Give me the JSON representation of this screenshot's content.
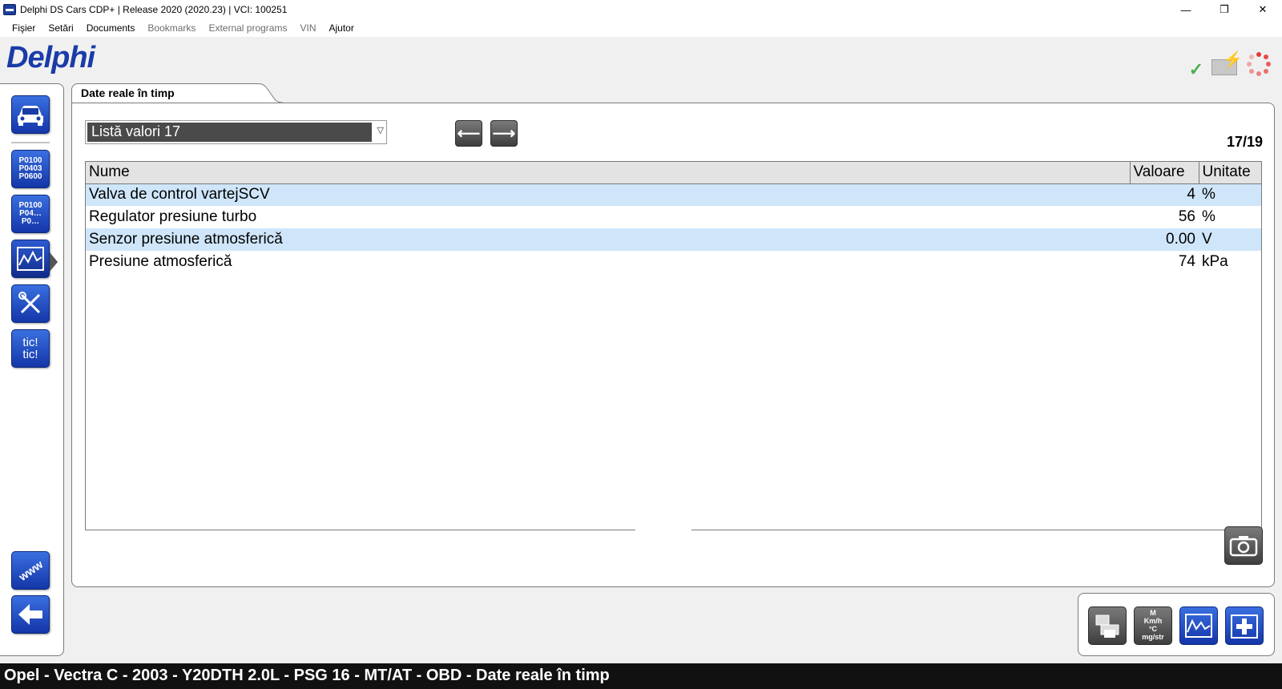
{
  "window": {
    "title": "Delphi DS Cars CDP+ | Release 2020 (2020.23)  |  VCI: 100251",
    "minimize": "—",
    "restore": "❐",
    "close": "✕"
  },
  "menu": {
    "items": [
      {
        "label": "Fişier",
        "enabled": true
      },
      {
        "label": "Setări",
        "enabled": true
      },
      {
        "label": "Documents",
        "enabled": true
      },
      {
        "label": "Bookmarks",
        "enabled": false
      },
      {
        "label": "External programs",
        "enabled": false
      },
      {
        "label": "VIN",
        "enabled": false
      },
      {
        "label": "Ajutor",
        "enabled": true
      }
    ]
  },
  "header": {
    "logo": "Delphi",
    "status": {
      "connection": "ok",
      "battery": "charging",
      "activity": "busy"
    }
  },
  "sidebar": {
    "buttons": [
      {
        "name": "vehicle",
        "icon": "car-icon",
        "label": ""
      },
      {
        "name": "read-codes",
        "icon": "dtc-icon",
        "label": "P0100 P0403 P0600"
      },
      {
        "name": "erase-codes",
        "icon": "dtc-erase-icon",
        "label": "P0100 P04… P0…"
      },
      {
        "name": "live-data",
        "icon": "live-data-icon",
        "label": ""
      },
      {
        "name": "service",
        "icon": "tools-icon",
        "label": ""
      },
      {
        "name": "activation",
        "icon": "tic-tic-icon",
        "label": "tic! tic!"
      },
      {
        "name": "web",
        "icon": "www-icon",
        "label": "www"
      },
      {
        "name": "back",
        "icon": "back-arrow-icon",
        "label": ""
      }
    ]
  },
  "main": {
    "tab_label": "Date reale în timp",
    "list_select": {
      "value": "Listă valori 17"
    },
    "counter": "17/19",
    "table": {
      "columns": [
        "Nume",
        "Valoare",
        "Unitate"
      ],
      "rows": [
        {
          "name": "Valva de control vartejSCV",
          "value": "4",
          "unit": "%"
        },
        {
          "name": "Regulator presiune turbo",
          "value": "56",
          "unit": "%"
        },
        {
          "name": "Senzor presiune atmosferică",
          "value": "0.00",
          "unit": "V"
        },
        {
          "name": "Presiune atmosferică",
          "value": "74",
          "unit": "kPa"
        }
      ]
    }
  },
  "actions": {
    "buttons": [
      {
        "name": "print",
        "icon": "printer-icon"
      },
      {
        "name": "units",
        "icon": "units-icon",
        "label": "M Km/h °C mg/str"
      },
      {
        "name": "graph",
        "icon": "graph-icon"
      },
      {
        "name": "add-parameters",
        "icon": "add-parameter-icon"
      }
    ]
  },
  "statusbar": {
    "text": "Opel - Vectra C - 2003 - Y20DTH 2.0L - PSG 16 - MT/AT - OBD - Date reale în timp"
  },
  "colors": {
    "accent_blue": "#1a3ca8",
    "row_highlight": "#cfe6fa",
    "statusbar_bg": "#111111"
  }
}
